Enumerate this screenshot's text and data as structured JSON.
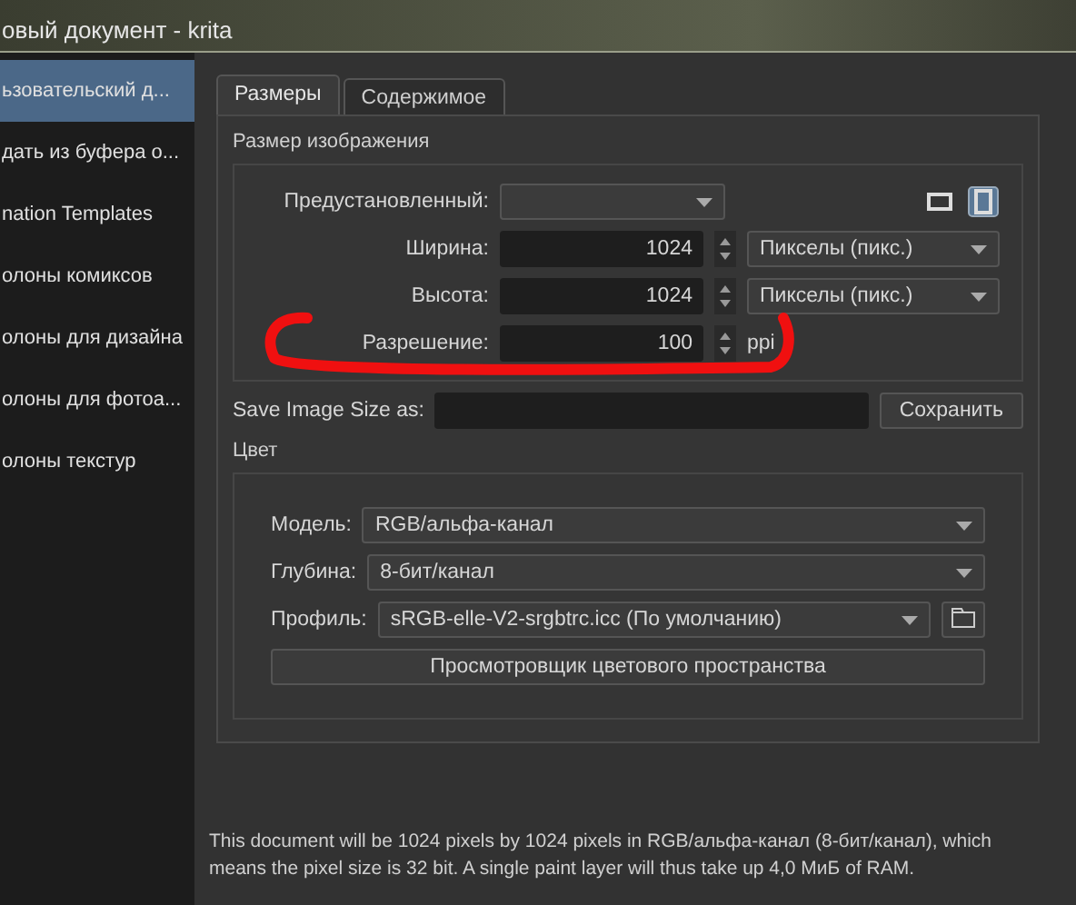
{
  "window": {
    "title": "овый документ - krita"
  },
  "sidebar": {
    "items": [
      {
        "label": "ьзовательский д...",
        "selected": true
      },
      {
        "label": "дать из буфера о...",
        "selected": false
      },
      {
        "label": "nation Templates",
        "selected": false
      },
      {
        "label": "олоны комиксов",
        "selected": false
      },
      {
        "label": "олоны для дизайна",
        "selected": false
      },
      {
        "label": "олоны для фотоа...",
        "selected": false
      },
      {
        "label": "олоны текстур",
        "selected": false
      }
    ]
  },
  "tabs": [
    {
      "label": "Размеры",
      "selected": true
    },
    {
      "label": "Содержимое",
      "selected": false
    }
  ],
  "image_size": {
    "title": "Размер изображения",
    "preset": {
      "label": "Предустановленный:"
    },
    "orientations": [
      {
        "kind": "landscape",
        "selected": false
      },
      {
        "kind": "portrait",
        "selected": true
      }
    ],
    "fields": [
      {
        "label": "Ширина:",
        "value": "1024",
        "unit": "Пикселы (пикс.)",
        "kind": "combo"
      },
      {
        "label": "Высота:",
        "value": "1024",
        "unit": "Пикселы (пикс.)",
        "kind": "combo"
      },
      {
        "label": "Разрешение:",
        "value": "100",
        "unit": "ppi",
        "kind": "text"
      }
    ],
    "save_label": "Save Image Size as:",
    "save_button": "Сохранить"
  },
  "color": {
    "title": "Цвет",
    "model": {
      "label": "Модель:",
      "value": "RGB/альфа-канал"
    },
    "depth": {
      "label": "Глубина:",
      "value": "8-бит/канал"
    },
    "profile": {
      "label": "Профиль:",
      "value": "sRGB-elle-V2-srgbtrc.icc (По умолчанию)"
    },
    "viewer_button": "Просмотровщик цветового пространства"
  },
  "info": "This document will be 1024 pixels by 1024 pixels in RGB/альфа-канал (8-бит/канал), which means the pixel size is 32 bit. A single paint layer will thus take up 4,0 МиБ of RAM."
}
